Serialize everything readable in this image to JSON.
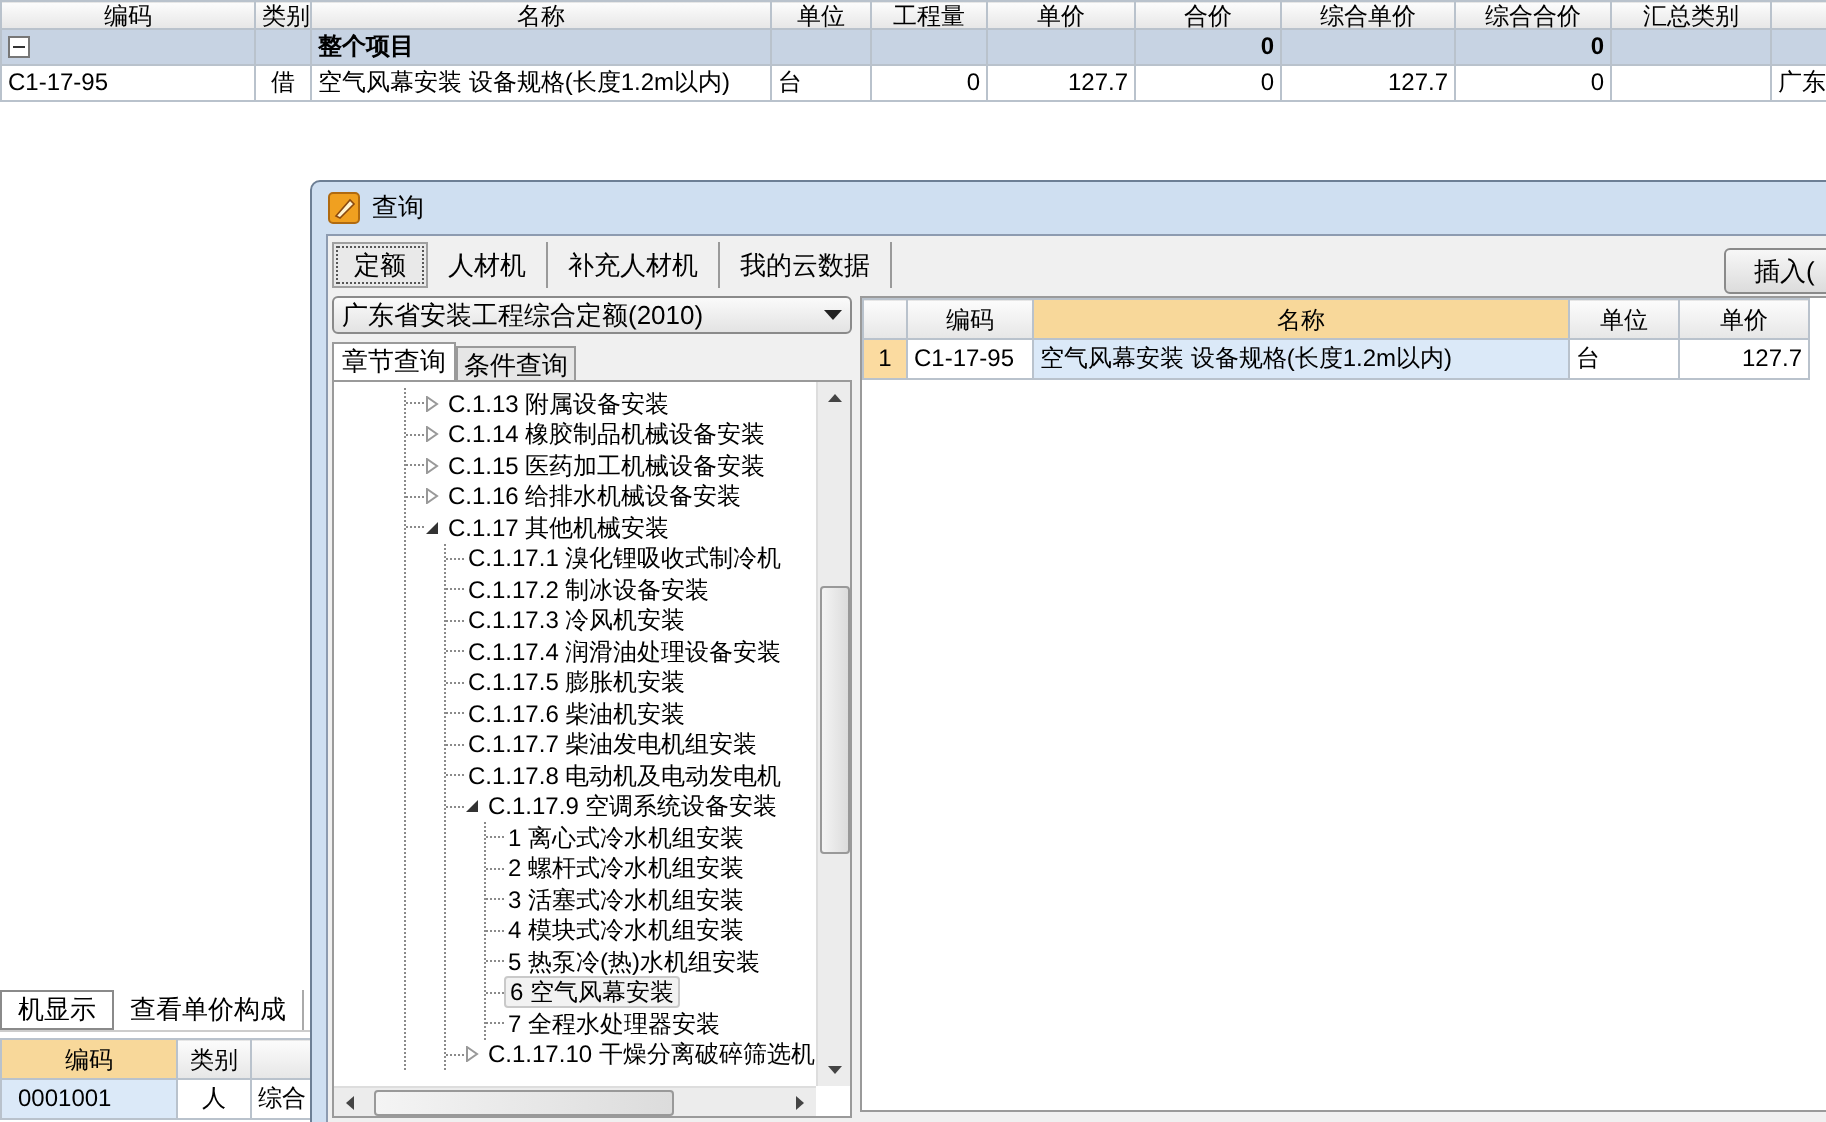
{
  "main_table": {
    "columns": [
      "编码",
      "类别",
      "名称",
      "单位",
      "工程量",
      "单价",
      "合价",
      "综合单价",
      "综合合价",
      "汇总类别",
      ""
    ],
    "rows": [
      {
        "kind": "group",
        "expanded": true,
        "cells": [
          "",
          "",
          "整个项目",
          "",
          "",
          "",
          "0",
          "",
          "0",
          "",
          ""
        ]
      },
      {
        "kind": "item",
        "cells": [
          "C1-17-95",
          "借",
          "空气风幕安装 设备规格(长度1.2m以内)",
          "台",
          "0",
          "127.7",
          "0",
          "127.7",
          "0",
          "",
          "广东"
        ]
      }
    ]
  },
  "bottom_panel": {
    "tabs": [
      {
        "label": "机显示",
        "selected": true
      },
      {
        "label": "查看单价构成",
        "selected": false
      }
    ],
    "table": {
      "columns": [
        {
          "label": "编码",
          "highlighted": true
        },
        {
          "label": "类别",
          "highlighted": false
        },
        {
          "highlighted": false
        }
      ],
      "rows": [
        {
          "selected": true,
          "cells": [
            "0001001",
            "人",
            "综合"
          ]
        }
      ]
    }
  },
  "dialog": {
    "title": "查询",
    "tabs": [
      {
        "label": "定额",
        "selected": true
      },
      {
        "label": "人材机",
        "selected": false
      },
      {
        "label": "补充人材机",
        "selected": false
      },
      {
        "label": "我的云数据",
        "selected": false
      }
    ],
    "insert_button": "插入(",
    "library_select": "广东省安装工程综合定额(2010)",
    "search_tabs": [
      {
        "label": "章节查询",
        "selected": true
      },
      {
        "label": "条件查询",
        "selected": false
      }
    ],
    "tree": [
      {
        "label": "C.1.13 附属设备安装",
        "expanded": false,
        "selected": false
      },
      {
        "label": "C.1.14 橡胶制品机械设备安装",
        "expanded": false,
        "selected": false
      },
      {
        "label": "C.1.15 医药加工机械设备安装",
        "expanded": false,
        "selected": false
      },
      {
        "label": "C.1.16 给排水机械设备安装",
        "expanded": false,
        "selected": false
      },
      {
        "label": "C.1.17 其他机械安装",
        "expanded": true,
        "selected": false,
        "children": [
          {
            "label": "C.1.17.1 溴化锂吸收式制冷机",
            "selected": false
          },
          {
            "label": "C.1.17.2 制冰设备安装",
            "selected": false
          },
          {
            "label": "C.1.17.3 冷风机安装",
            "selected": false
          },
          {
            "label": "C.1.17.4 润滑油处理设备安装",
            "selected": false
          },
          {
            "label": "C.1.17.5 膨胀机安装",
            "selected": false
          },
          {
            "label": "C.1.17.6 柴油机安装",
            "selected": false
          },
          {
            "label": "C.1.17.7 柴油发电机组安装",
            "selected": false
          },
          {
            "label": "C.1.17.8 电动机及电动发电机",
            "selected": false
          },
          {
            "label": "C.1.17.9 空调系统设备安装",
            "expanded": true,
            "selected": false,
            "children": [
              {
                "label": "1 离心式冷水机组安装",
                "selected": false
              },
              {
                "label": "2 螺杆式冷水机组安装",
                "selected": false
              },
              {
                "label": "3 活塞式冷水机组安装",
                "selected": false
              },
              {
                "label": "4 模块式冷水机组安装",
                "selected": false
              },
              {
                "label": "5 热泵冷(热)水机组安装",
                "selected": false
              },
              {
                "label": "6 空气风幕安装",
                "selected": true
              },
              {
                "label": "7 全程水处理器安装",
                "selected": false
              }
            ]
          },
          {
            "label": "C.1.17.10 干燥分离破碎筛选机",
            "expanded": false,
            "selected": false
          }
        ]
      }
    ],
    "results": {
      "columns": [
        {
          "highlighted": false
        },
        {
          "label": "编码",
          "highlighted": false
        },
        {
          "label": "名称",
          "highlighted": true
        },
        {
          "label": "单位",
          "highlighted": false
        },
        {
          "label": "单价",
          "highlighted": false
        }
      ],
      "rows": [
        {
          "selected": true,
          "cells": [
            "1",
            "C1-17-95",
            "空气风幕安装 设备规格(长度1.2m以内)",
            "台",
            "127.7"
          ]
        }
      ]
    }
  }
}
